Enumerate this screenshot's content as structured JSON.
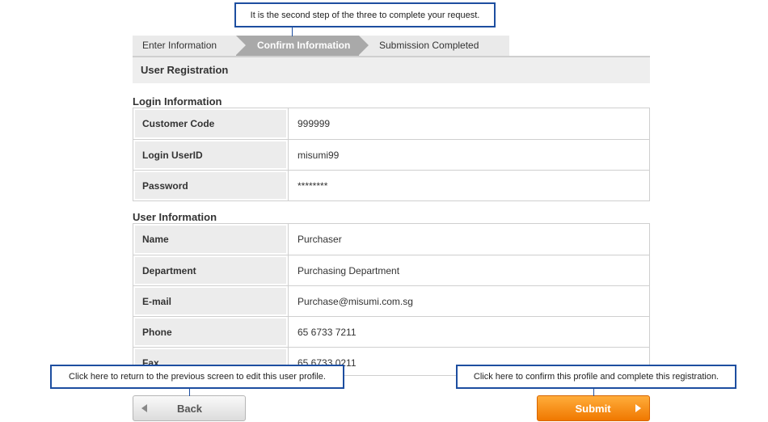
{
  "callouts": {
    "step": "It is the second step of the three to complete your request.",
    "back": "Click here to return to the previous screen to edit this user profile.",
    "submit": "Click here to confirm this profile and complete this registration."
  },
  "steps": [
    "Enter Information",
    "Confirm Information",
    "Submission Completed"
  ],
  "section_title": "User Registration",
  "login_info": {
    "title": "Login Information",
    "rows": [
      {
        "label": "Customer Code",
        "value": "999999"
      },
      {
        "label": "Login UserID",
        "value": "misumi99"
      },
      {
        "label": "Password",
        "value": "********"
      }
    ]
  },
  "user_info": {
    "title": "User Information",
    "rows": [
      {
        "label": "Name",
        "value": "Purchaser"
      },
      {
        "label": "Department",
        "value": "Purchasing Department"
      },
      {
        "label": "E-mail",
        "value": "Purchase@misumi.com.sg"
      },
      {
        "label": "Phone",
        "value": "65 6733 7211"
      },
      {
        "label": "Fax",
        "value": "65 6733 0211"
      }
    ]
  },
  "buttons": {
    "back": "Back",
    "submit": "Submit"
  },
  "colors": {
    "callout_border": "#1d4ea0",
    "active_step": "#a9a9a9",
    "submit_orange": "#f07800"
  }
}
